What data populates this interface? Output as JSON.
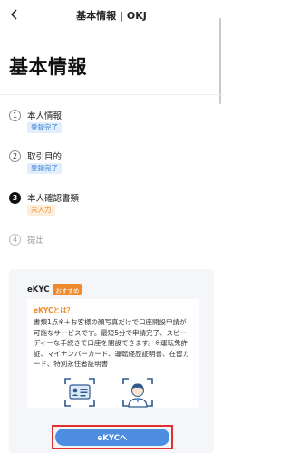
{
  "header": {
    "title": "基本情報 | OKJ"
  },
  "page": {
    "title": "基本情報"
  },
  "steps": [
    {
      "number": "1",
      "label": "本人情報",
      "badge": "登録完了",
      "status": "done"
    },
    {
      "number": "2",
      "label": "取引目的",
      "badge": "登録完了",
      "status": "done"
    },
    {
      "number": "3",
      "label": "本人確認書類",
      "badge": "未入力",
      "status": "active"
    },
    {
      "number": "4",
      "label": "提出",
      "badge": "",
      "status": "pending"
    }
  ],
  "ekyc": {
    "title": "eKYC",
    "recommend_badge": "おすすめ",
    "question": "eKYCとは？",
    "description": "書類1点※＋お客様の顔写真だけで口座開設申請が可能なサービスです。最短5分で申請完了、スピーディーな手続きで口座を開設できます。※運転免許証、マイナンバーカード、運転経歴証明書、在留カード、特別永住者証明書",
    "button_label": "eKYCへ"
  },
  "colors": {
    "accent_orange": "#ee8a2b",
    "accent_blue": "#4e8ee0",
    "highlight_red": "#e03131"
  },
  "icons": {
    "back": "chevron-left-icon",
    "id_card": "id-card-icon",
    "face": "face-scan-icon"
  }
}
